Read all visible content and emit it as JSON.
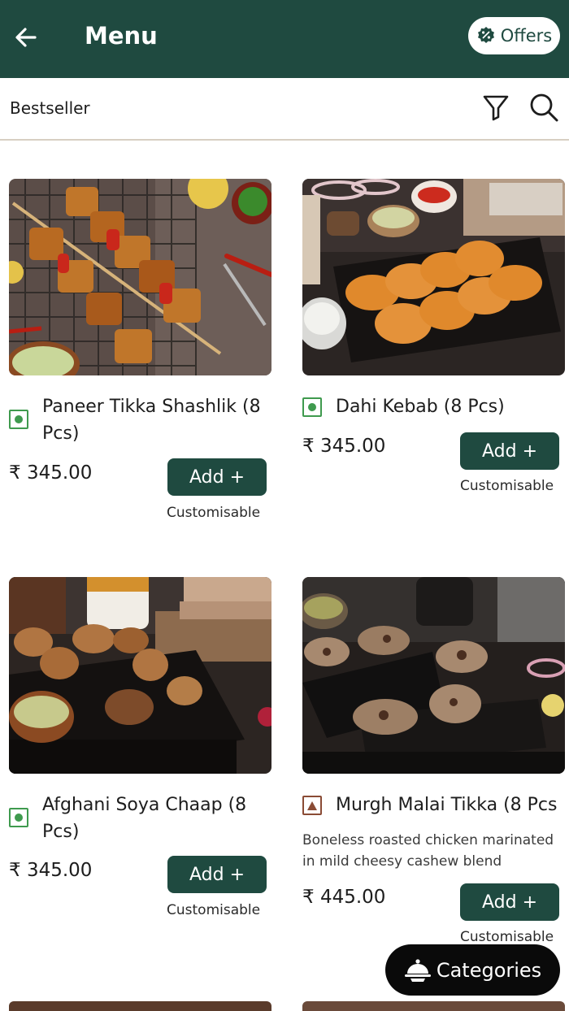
{
  "header": {
    "title": "Menu",
    "offers_label": "Offers",
    "icons": {
      "back": "arrow-left-icon",
      "offers": "discount-badge-icon"
    }
  },
  "toolbar": {
    "section_label": "Bestseller",
    "icons": {
      "filter": "filter-icon",
      "search": "search-icon"
    }
  },
  "items": [
    {
      "name": "Paneer Tikka Shashlik (8 Pcs)",
      "price": "₹ 345.00",
      "add_label": "Add +",
      "customisable": "Customisable",
      "diet": "veg",
      "image": "paneer-tikka-skewers-photo"
    },
    {
      "name": "Dahi Kebab (8 Pcs)",
      "price": "₹ 345.00",
      "add_label": "Add +",
      "customisable": "Customisable",
      "diet": "veg",
      "image": "dahi-kebab-tray-photo"
    },
    {
      "name": "Afghani Soya Chaap (8 Pcs)",
      "price": "₹ 345.00",
      "add_label": "Add +",
      "customisable": "Customisable",
      "diet": "veg",
      "image": "soya-chaap-board-photo"
    },
    {
      "name": "Murgh Malai Tikka (8 Pcs",
      "description": "Boneless roasted chicken marinated in mild cheesy cashew blend",
      "price": "₹ 445.00",
      "add_label": "Add +",
      "customisable": "Customisable",
      "diet": "non-veg",
      "image": "malai-tikka-board-photo"
    }
  ],
  "floating": {
    "categories_label": "Categories",
    "icon": "food-cloche-icon"
  },
  "colors": {
    "brand": "#1f4a40",
    "veg": "#3f9a4e",
    "nonveg": "#8a4b35",
    "fab": "#0a0a0a"
  }
}
